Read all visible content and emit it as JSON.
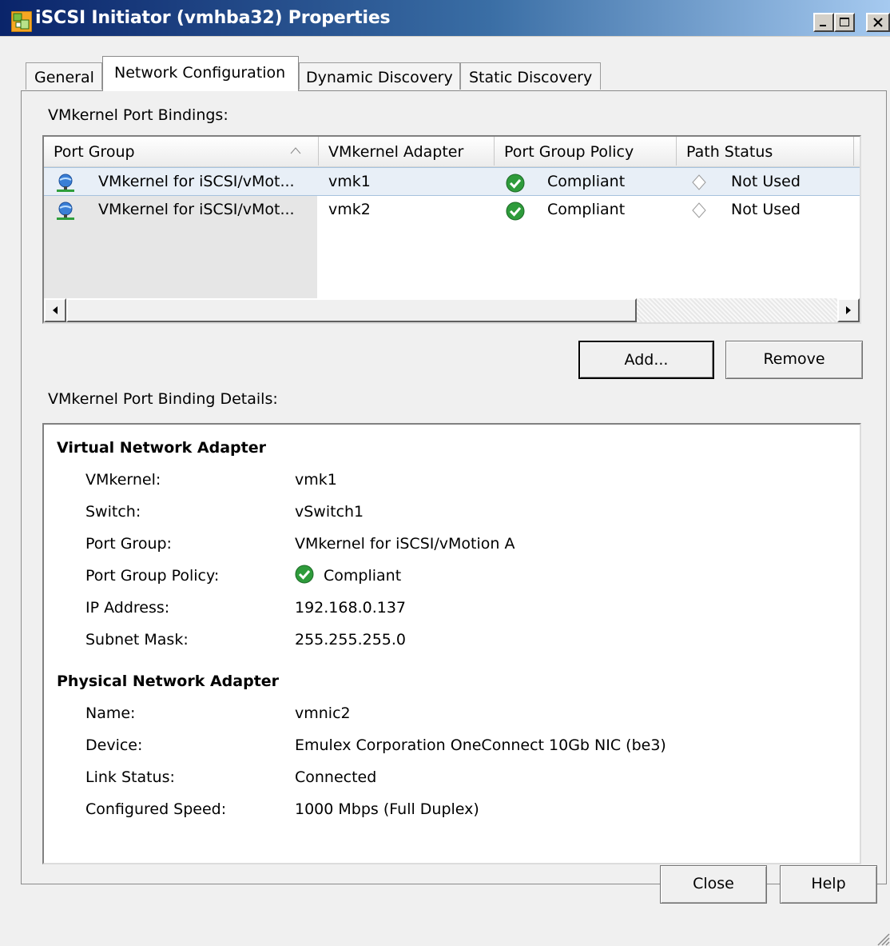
{
  "window": {
    "title": "iSCSI Initiator (vmhba32) Properties"
  },
  "tabs": [
    {
      "label": "General",
      "selected": false
    },
    {
      "label": "Network Configuration",
      "selected": true
    },
    {
      "label": "Dynamic Discovery",
      "selected": false
    },
    {
      "label": "Static Discovery",
      "selected": false
    }
  ],
  "bindings": {
    "section_label": "VMkernel Port Bindings:",
    "columns": [
      "Port Group",
      "VMkernel Adapter",
      "Port Group Policy",
      "Path Status"
    ],
    "sort_icon": "sort-up-icon",
    "rows": [
      {
        "port_group": "VMkernel for iSCSI/vMot...",
        "adapter": "vmk1",
        "policy": "Compliant",
        "path_status": "Not Used",
        "selected": true
      },
      {
        "port_group": "VMkernel for iSCSI/vMot...",
        "adapter": "vmk2",
        "policy": "Compliant",
        "path_status": "Not Used",
        "selected": false
      }
    ]
  },
  "buttons": {
    "add": "Add...",
    "remove": "Remove",
    "close": "Close",
    "help": "Help"
  },
  "details": {
    "section_label": "VMkernel Port Binding Details:",
    "virtual": {
      "heading": "Virtual Network Adapter",
      "vmkernel_label": "VMkernel:",
      "vmkernel": "vmk1",
      "switch_label": "Switch:",
      "switch": "vSwitch1",
      "port_group_label": "Port Group:",
      "port_group": "VMkernel for iSCSI/vMotion A",
      "policy_label": "Port Group Policy:",
      "policy": "Compliant",
      "ip_label": "IP Address:",
      "ip": "192.168.0.137",
      "mask_label": "Subnet Mask:",
      "mask": "255.255.255.0"
    },
    "physical": {
      "heading": "Physical Network Adapter",
      "name_label": "Name:",
      "name": "vmnic2",
      "device_label": "Device:",
      "device": "Emulex Corporation OneConnect 10Gb NIC (be3)",
      "link_label": "Link Status:",
      "link": "Connected",
      "speed_label": "Configured Speed:",
      "speed": "1000 Mbps (Full Duplex)"
    }
  },
  "colors": {
    "compliant_green": "#2e9b3b",
    "selection": "#e8eff7",
    "titlebar": "#0a246a"
  }
}
